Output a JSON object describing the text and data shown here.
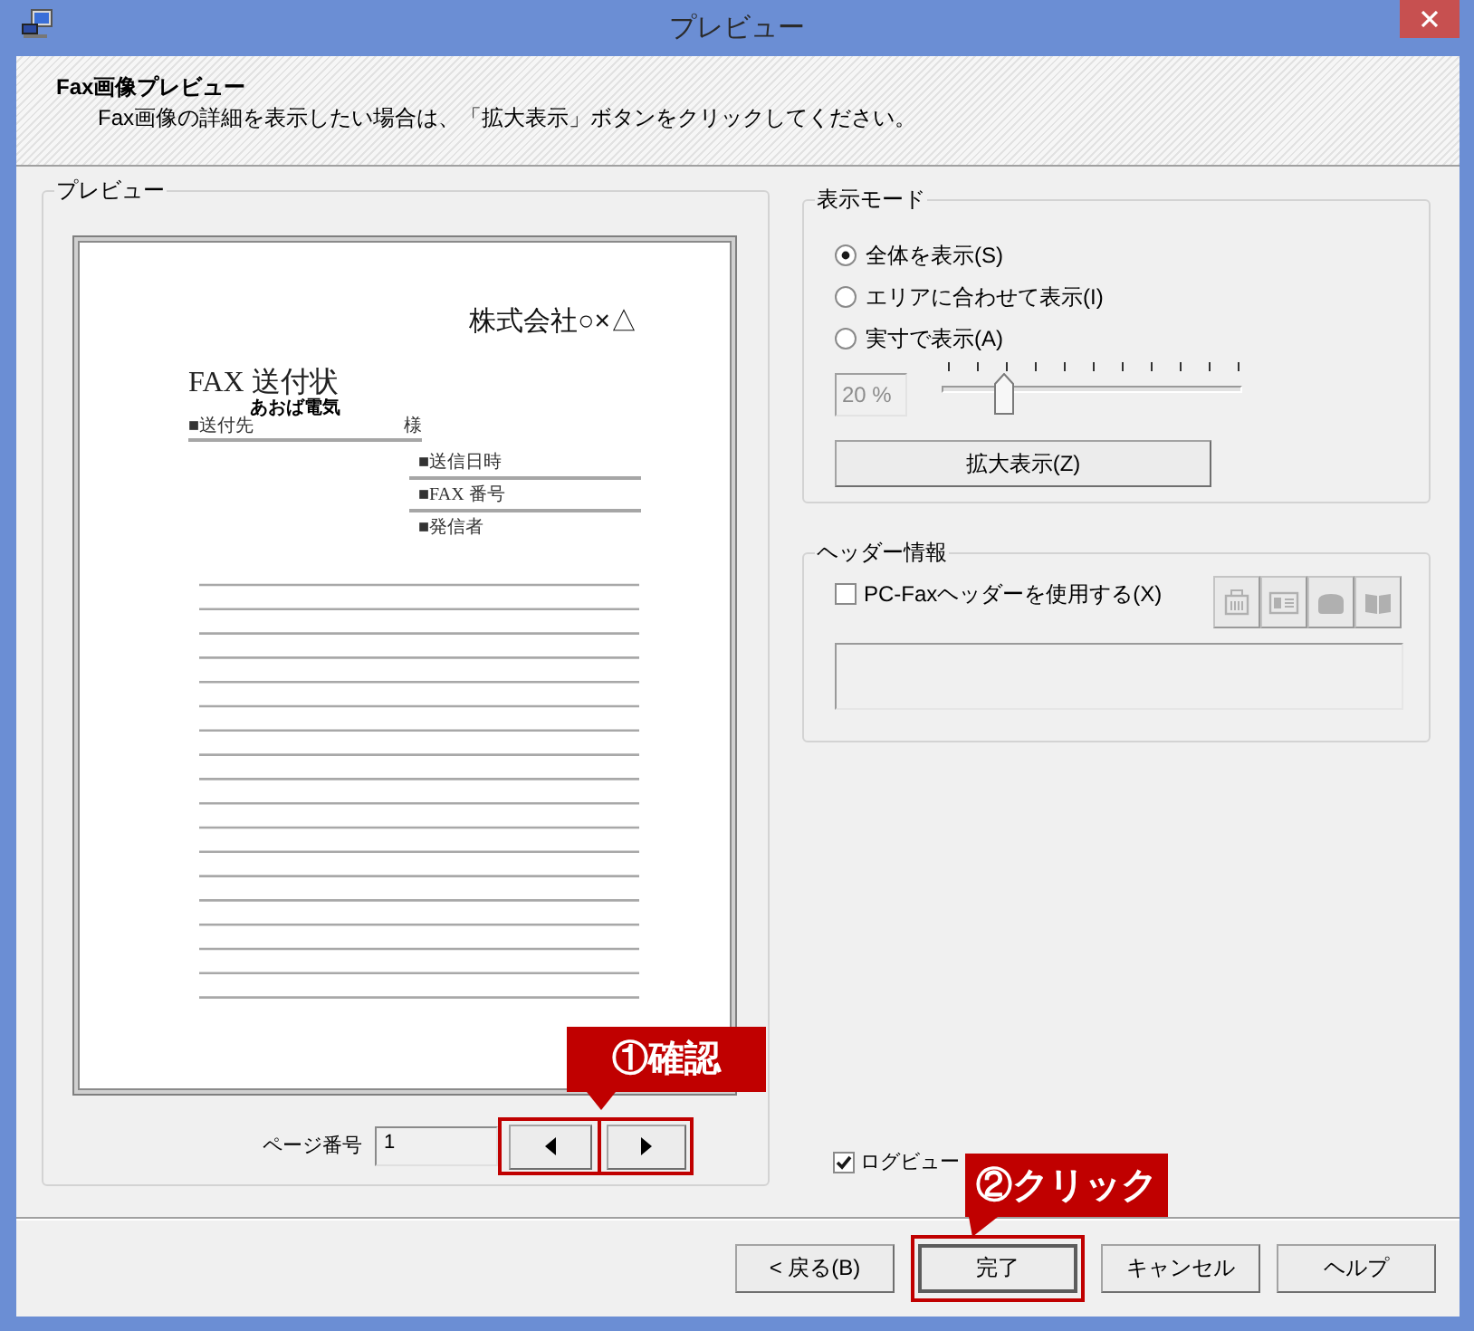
{
  "window": {
    "title": "プレビュー"
  },
  "header": {
    "title": "Fax画像プレビュー",
    "description": "Fax画像の詳細を表示したい場合は、「拡大表示」ボタンをクリックしてください。"
  },
  "preview": {
    "label": "プレビュー",
    "document": {
      "company": "株式会社○×△",
      "title": "FAX 送付状",
      "recipient": {
        "name": "あおば電気",
        "label": "■送付先",
        "honorific": "様"
      },
      "fields": [
        "■送信日時",
        "■FAX 番号",
        "■発信者"
      ]
    },
    "page_number": {
      "label": "ページ番号",
      "value": "1"
    },
    "page_nav": {
      "highlighted": true
    }
  },
  "display_mode": {
    "label": "表示モード",
    "options": [
      {
        "label": "全体を表示(S)",
        "selected": true
      },
      {
        "label": "エリアに合わせて表示(I)",
        "selected": false
      },
      {
        "label": "実寸で表示(A)",
        "selected": false
      }
    ],
    "zoom_field": {
      "value": "20 %",
      "disabled": true
    },
    "zoom_slider": {
      "level": 0.19
    },
    "zoom_button": "拡大表示(Z)"
  },
  "header_info": {
    "label": "ヘッダー情報",
    "use_header": {
      "label": "PC-Faxヘッダーを使用する(X)",
      "checked": false
    },
    "tools": {
      "disabled": true
    }
  },
  "log_view": {
    "label": "ログビュー",
    "checked": true
  },
  "buttons": [
    {
      "label": "< 戻る(B)",
      "default": false,
      "highlighted": false
    },
    {
      "label": "完了",
      "default": true,
      "highlighted": true
    },
    {
      "label": "キャンセル",
      "default": false,
      "highlighted": false
    },
    {
      "label": "ヘルプ",
      "default": false,
      "highlighted": false
    }
  ],
  "annotations": [
    {
      "text": "①確認"
    },
    {
      "text": "②クリック"
    }
  ]
}
